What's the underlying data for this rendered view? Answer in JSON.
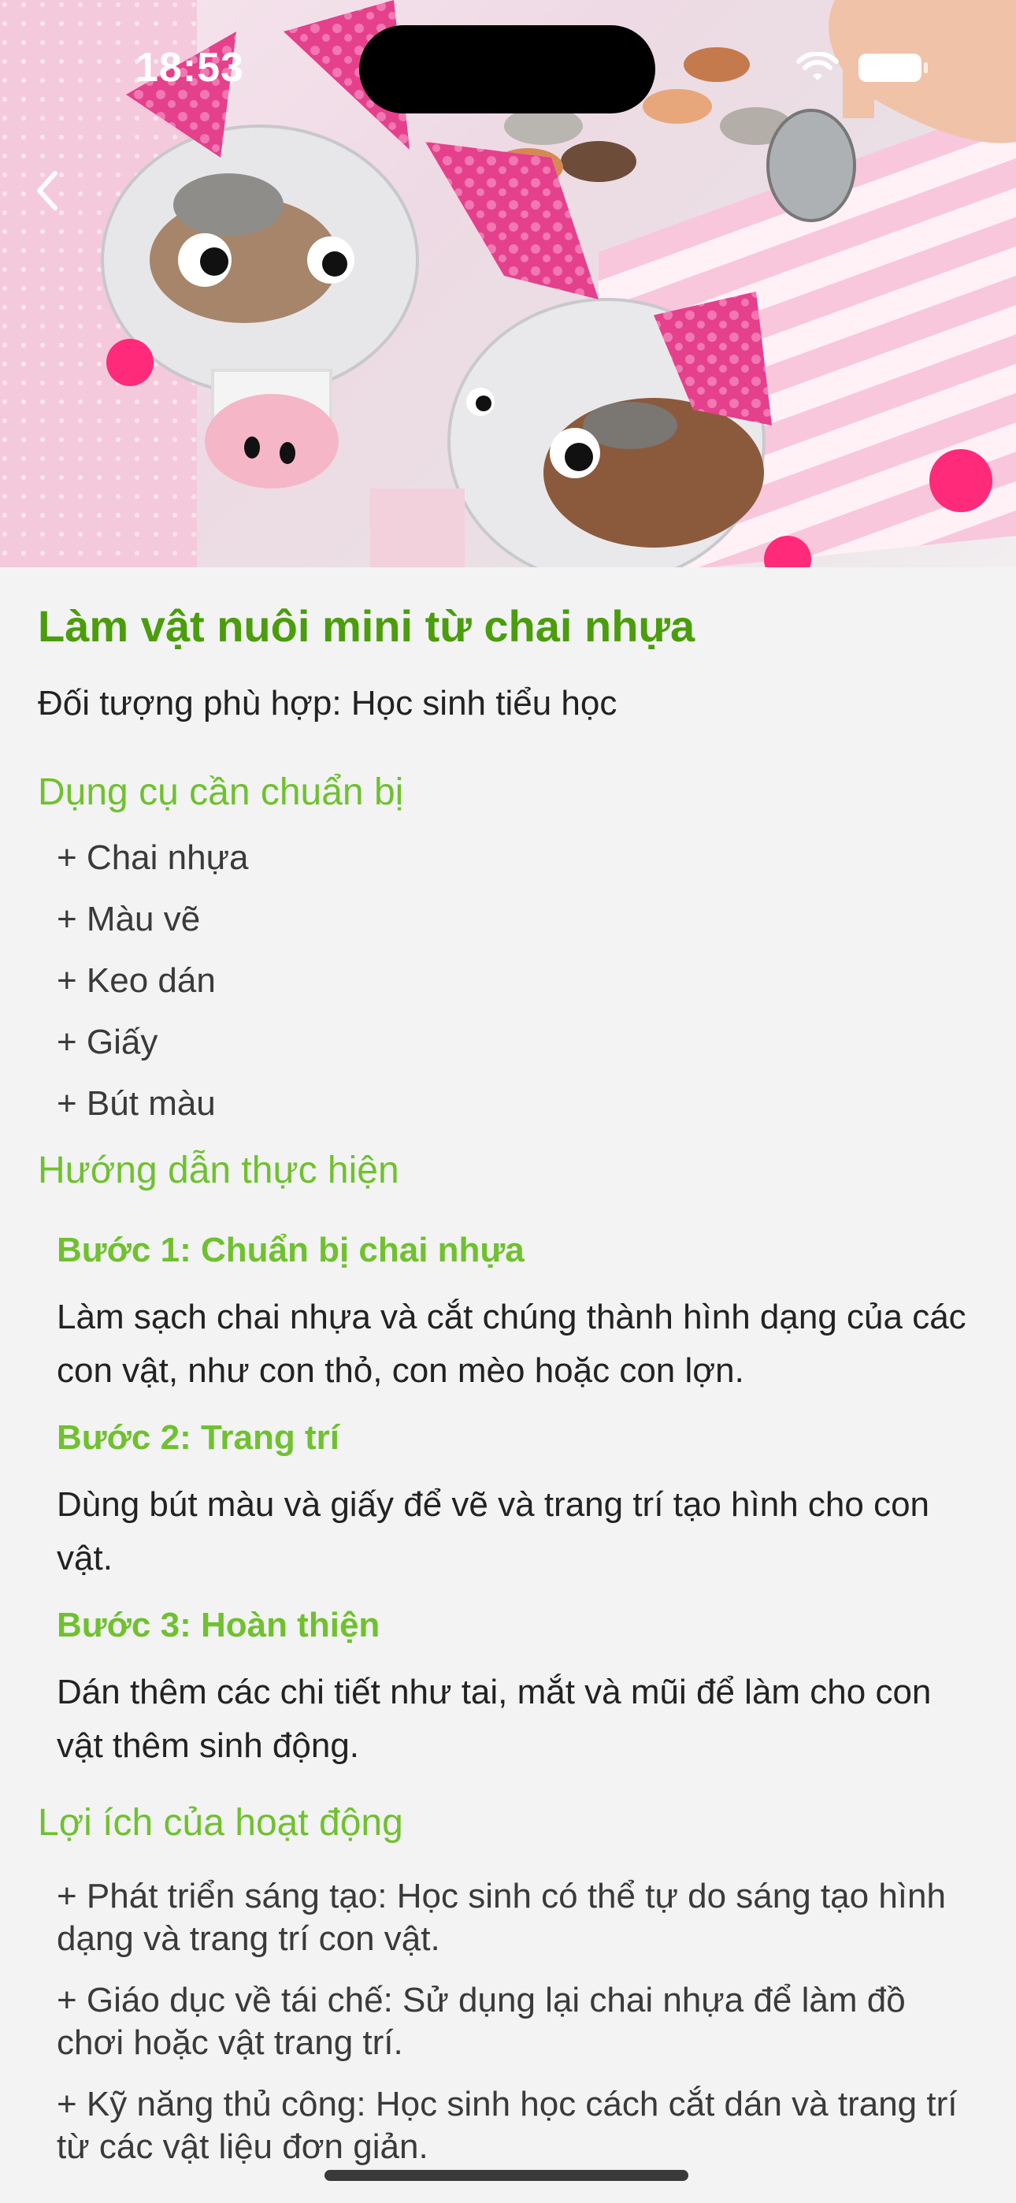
{
  "status_bar": {
    "time": "18:53"
  },
  "hero": {
    "image_description_icon": "piggy-bank-photo"
  },
  "article": {
    "title": "Làm vật nuôi mini từ chai nhựa",
    "audience": "Đối tượng phù hợp: Học sinh tiểu học",
    "tools_heading": "Dụng cụ cần chuẩn bị",
    "tools": [
      "+ Chai nhựa",
      "+ Màu vẽ",
      "+ Keo dán",
      "+ Giấy",
      "+ Bút màu"
    ],
    "guide_heading": "Hướng dẫn thực hiện",
    "steps": [
      {
        "title": "Bước 1: Chuẩn bị chai nhựa",
        "text": "Làm sạch chai nhựa và cắt chúng thành hình dạng của các con vật, như con thỏ, con mèo hoặc con lợn."
      },
      {
        "title": "Bước 2: Trang trí",
        "text": "Dùng bút màu và giấy để vẽ và trang trí tạo hình cho con vật."
      },
      {
        "title": "Bước 3: Hoàn thiện",
        "text": "Dán thêm các chi tiết như tai, mắt và mũi để làm cho con vật thêm sinh động."
      }
    ],
    "benefits_heading": "Lợi ích của hoạt động",
    "benefits": [
      "+ Phát triển sáng tạo: Học sinh có thể tự do sáng tạo hình dạng và trang trí con vật.",
      "+ Giáo dục về tái chế: Sử dụng lại chai nhựa để làm đồ chơi hoặc vật trang trí.",
      "+ Kỹ năng thủ công: Học sinh học cách cắt dán và trang trí từ các vật liệu đơn giản."
    ]
  }
}
